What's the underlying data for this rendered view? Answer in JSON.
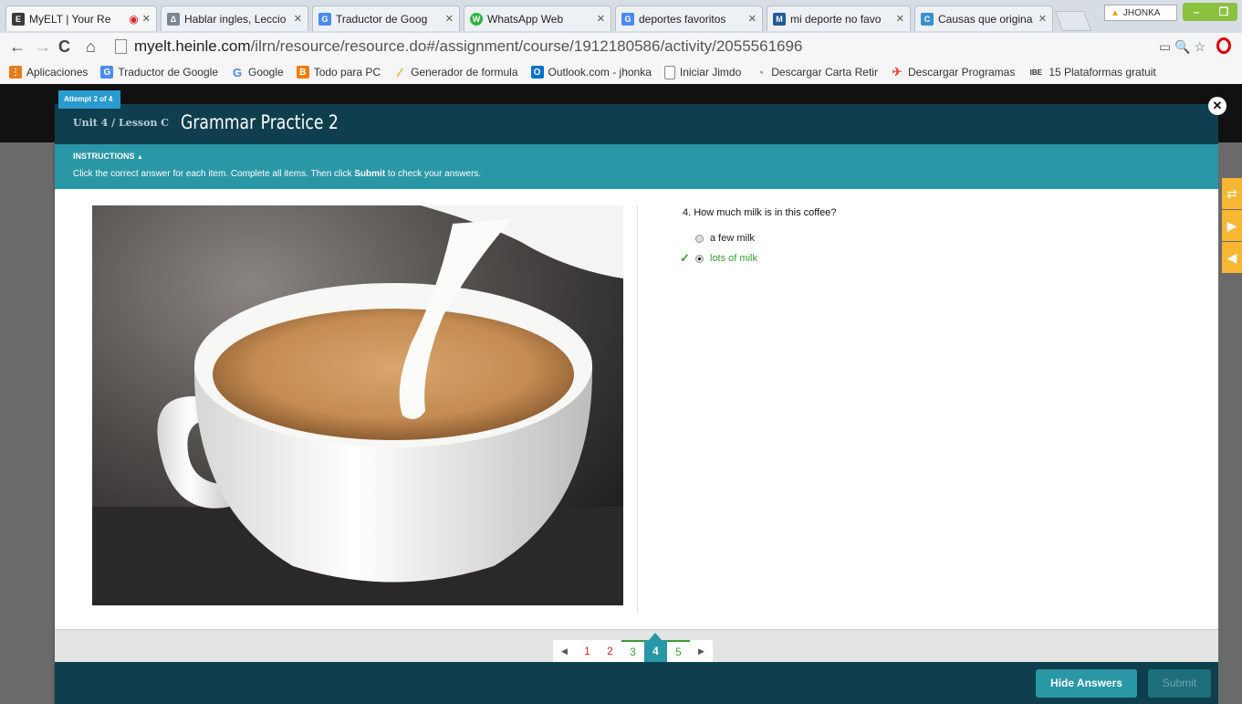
{
  "browser": {
    "tabs": [
      {
        "title": "MyELT | Your Re",
        "icon": "E",
        "icon_color": "#3a3a3a",
        "active": true
      },
      {
        "title": "Hablar ingles, Leccio",
        "icon": "Δ",
        "icon_color": "#7a8793"
      },
      {
        "title": "Traductor de Goog",
        "icon": "G",
        "icon_color": "#4a8af4"
      },
      {
        "title": "WhatsApp Web",
        "icon": "W",
        "icon_color": "#2ab540"
      },
      {
        "title": "deportes favoritos",
        "icon": "G",
        "icon_color": "#4a8af4"
      },
      {
        "title": "mi deporte no favo",
        "icon": "M",
        "icon_color": "#1f5a9a"
      },
      {
        "title": "Causas que origina",
        "icon": "C",
        "icon_color": "#3a8fd0"
      }
    ],
    "profile_name": "JHONKA",
    "url_host": "myelt.heinle.com",
    "url_path": "/ilrn/resource/resource.do#/assignment/course/1912180586/activity/2055561696",
    "bookmarks": [
      {
        "label": "Aplicaciones",
        "icon": "apps-icon",
        "color": "#e57c1f"
      },
      {
        "label": "Traductor de Google",
        "icon": "translate-icon",
        "color": "#4a8af4"
      },
      {
        "label": "Google",
        "icon": "google-icon",
        "color": "#4a8af4"
      },
      {
        "label": "Todo para PC",
        "icon": "blogger-icon",
        "color": "#f57d00"
      },
      {
        "label": "Generador de formula",
        "icon": "pencil-icon",
        "color": "#e9a500"
      },
      {
        "label": "Outlook.com - jhonka",
        "icon": "outlook-icon",
        "color": "#0072c6"
      },
      {
        "label": "Iniciar Jimdo",
        "icon": "page-icon",
        "color": "#888888"
      },
      {
        "label": "Descargar Carta Retir",
        "icon": "globe-icon",
        "color": "#999999"
      },
      {
        "label": "Descargar Programas",
        "icon": "bird-icon",
        "color": "#e94b3c"
      },
      {
        "label": "15 Plataformas gratuit",
        "icon": "ibe-icon",
        "color": "#333333"
      }
    ]
  },
  "activity": {
    "attempt": "Attempt 2 of 4",
    "unit": "Unit 4 / Lesson C",
    "title": "Grammar Practice 2",
    "instructions_heading": "INSTRUCTIONS",
    "instructions_pre": "Click the correct answer for each item. Complete all items. Then click ",
    "instructions_bold": "Submit",
    "instructions_post": " to check your answers.",
    "question": "4. How much milk is in this coffee?",
    "options": [
      {
        "label": "a few milk",
        "selected": false
      },
      {
        "label": "lots of milk",
        "selected": true,
        "correct": true
      }
    ],
    "pages": [
      {
        "label": "1",
        "status": "wrong"
      },
      {
        "label": "2",
        "status": "wrong"
      },
      {
        "label": "3",
        "status": "right"
      },
      {
        "label": "4",
        "status": "current"
      },
      {
        "label": "5",
        "status": "right"
      }
    ],
    "hide_answers_label": "Hide Answers",
    "submit_label": "Submit"
  },
  "colors": {
    "header": "#0f3f4e",
    "instructions": "#2a97a6",
    "correct": "#3d9a38",
    "wrong": "#d9232d",
    "side_tab": "#f7b733"
  }
}
